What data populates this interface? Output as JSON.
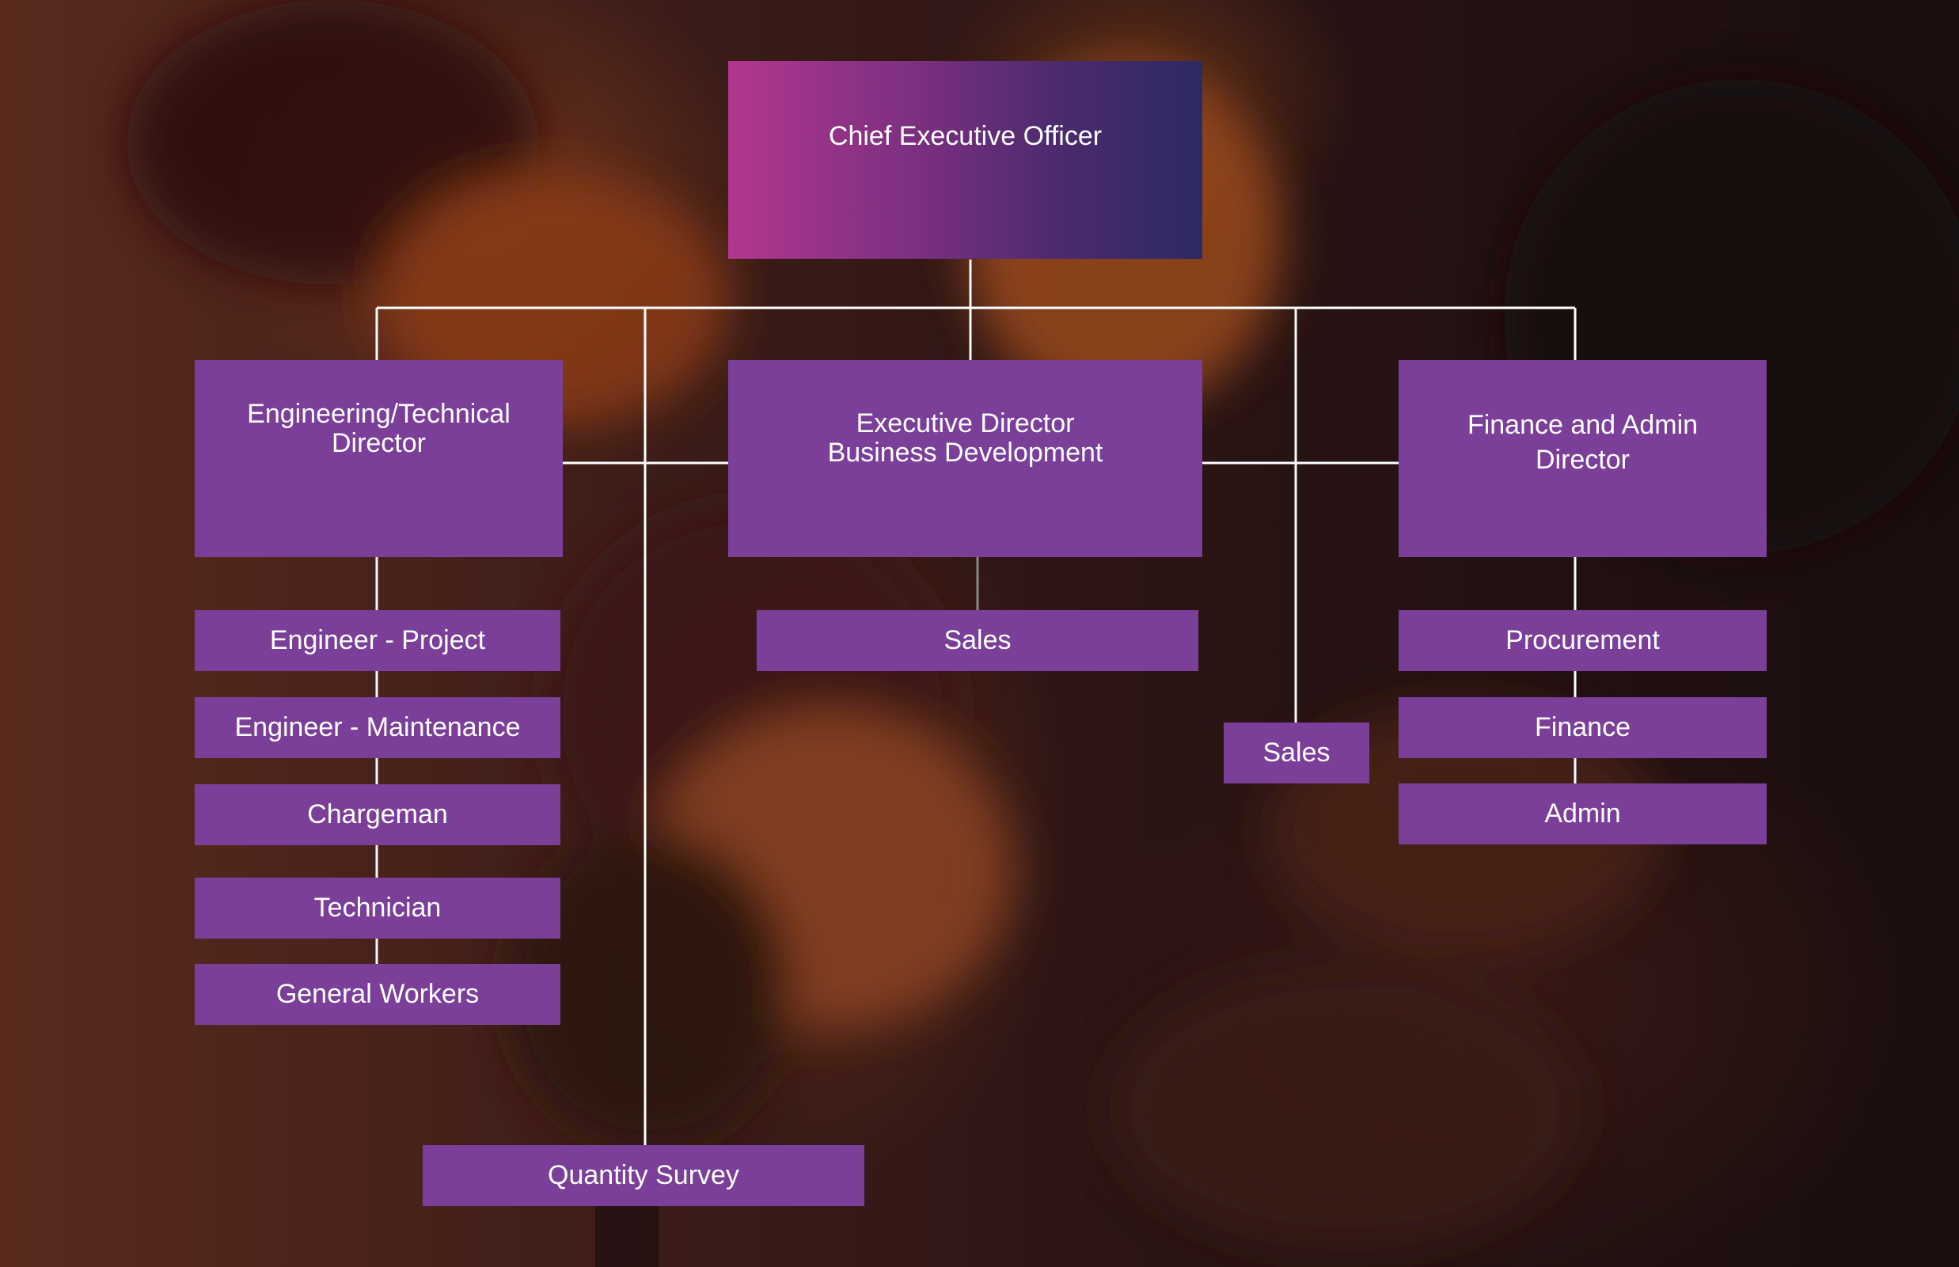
{
  "colors": {
    "box": "#7b3f9a",
    "ceo_gradient_start": "#b2378f",
    "ceo_gradient_end": "#2c2a62",
    "connector": "#ffffff",
    "text": "#ffffff"
  },
  "org_chart": {
    "ceo": "Chief Executive Officer",
    "directors": {
      "engineering": "Engineering/Technical\nDirector",
      "business_development": "Executive Director\nBusiness Development",
      "finance_admin": "Finance and Admin\nDirector"
    },
    "engineering_staff": [
      "Engineer - Project",
      "Engineer - Maintenance",
      "Chargeman",
      "Technician",
      "General Workers"
    ],
    "business_dev_staff": [
      "Sales"
    ],
    "finance_admin_staff": [
      "Procurement",
      "Finance",
      "Admin"
    ],
    "direct_reports": {
      "quantity_survey": "Quantity Survey",
      "sales": "Sales"
    }
  }
}
